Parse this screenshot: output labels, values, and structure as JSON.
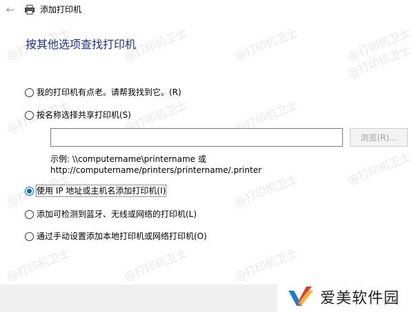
{
  "window": {
    "title": "添加打印机",
    "back_icon": "arrow-left-icon",
    "printer_icon": "printer-icon"
  },
  "heading": "按其他选项查找打印机",
  "options": [
    {
      "label": "我的打印机有点老。请帮我找到它。(R)",
      "checked": false
    },
    {
      "label": "按名称选择共享打印机(S)",
      "checked": false
    },
    {
      "label": "使用 IP 地址或主机名添加打印机(I)",
      "checked": true
    },
    {
      "label": "添加可检测到蓝牙、无线或网络的打印机(L)",
      "checked": false
    },
    {
      "label": "通过手动设置添加本地打印机或网络打印机(O)",
      "checked": false
    }
  ],
  "shared_printer": {
    "input_value": "",
    "browse_label": "浏览(R)...",
    "example_line1": "示例: \\\\computername\\printername 或",
    "example_line2": "http://computername/printers/printername/.printer"
  },
  "watermark": {
    "text": "@打印机卫士",
    "brand_text": "爱美软件园"
  },
  "colors": {
    "heading": "#1e3287",
    "radio_selected": "#0067c0",
    "bottom_bar": "#f0f0f0"
  }
}
